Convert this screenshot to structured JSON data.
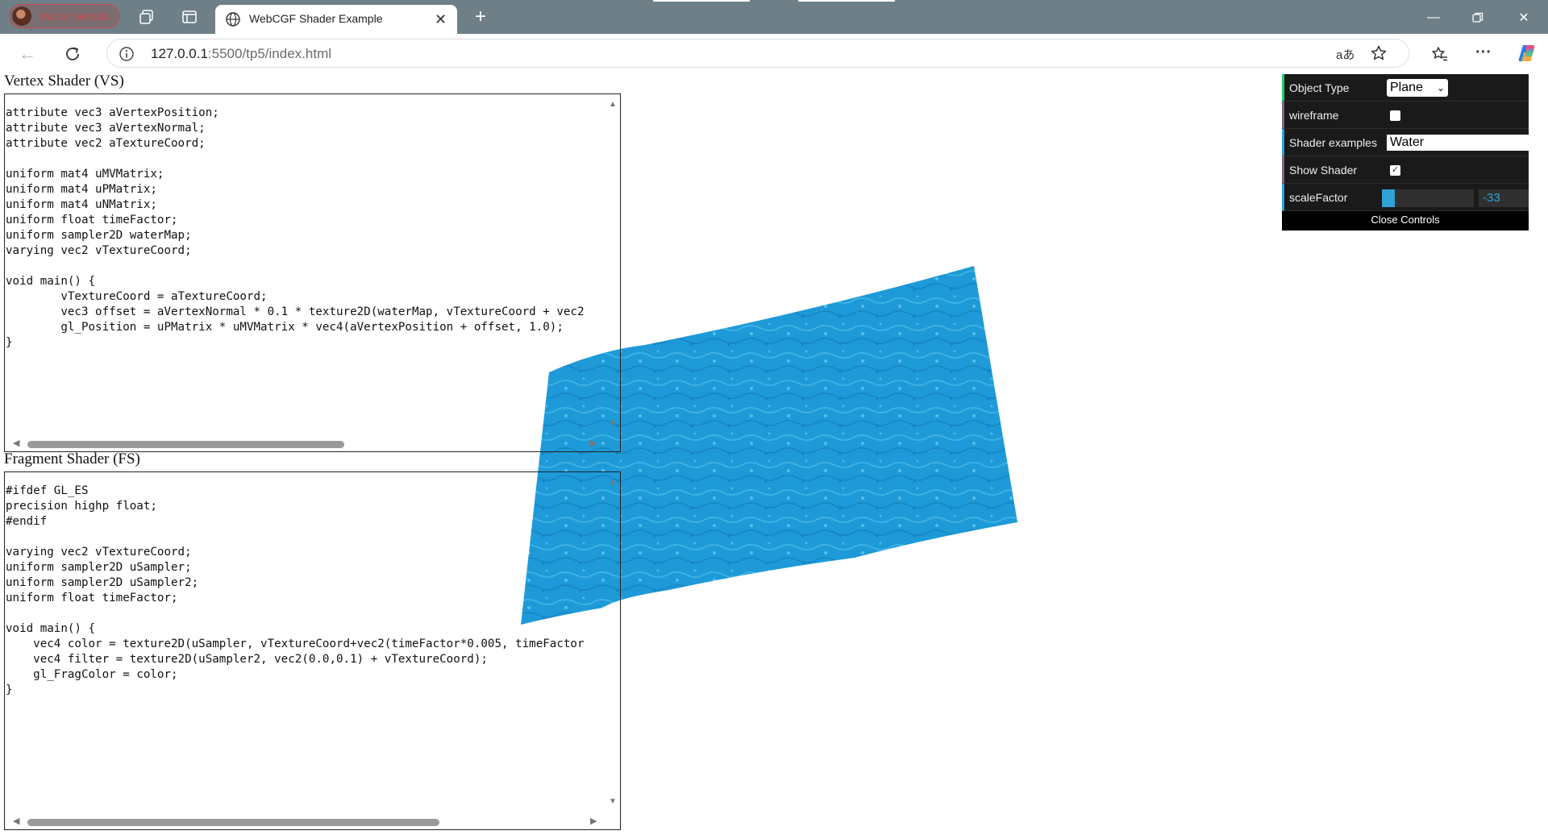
{
  "browser": {
    "profile_label": "Iniciar sessão",
    "tab_title": "WebCGF Shader Example",
    "url_host": "127.0.0.1",
    "url_rest": ":5500/tp5/index.html",
    "read_aloud_glyph": "aあ"
  },
  "vertex": {
    "title": "Vertex Shader (VS)",
    "code": "attribute vec3 aVertexPosition;\nattribute vec3 aVertexNormal;\nattribute vec2 aTextureCoord;\n\nuniform mat4 uMVMatrix;\nuniform mat4 uPMatrix;\nuniform mat4 uNMatrix;\nuniform float timeFactor;\nuniform sampler2D waterMap;\nvarying vec2 vTextureCoord;\n\nvoid main() {\n\tvTextureCoord = aTextureCoord;\n\tvec3 offset = aVertexNormal * 0.1 * texture2D(waterMap, vTextureCoord + vec2\n\tgl_Position = uPMatrix * uMVMatrix * vec4(aVertexPosition + offset, 1.0);\n}",
    "scroll_fraction": 0.57
  },
  "fragment": {
    "title": "Fragment Shader (FS)",
    "code": "#ifdef GL_ES\nprecision highp float;\n#endif\n\nvarying vec2 vTextureCoord;\nuniform sampler2D uSampler;\nuniform sampler2D uSampler2;\nuniform float timeFactor;\n\nvoid main() {\n    vec4 color = texture2D(uSampler, vTextureCoord+vec2(timeFactor*0.005, timeFactor\n    vec4 filter = texture2D(uSampler2, vec2(0.0,0.1) + vTextureCoord);\n    gl_FragColor = color;\n}",
    "scroll_fraction": 0.74
  },
  "gui": {
    "object_type_label": "Object Type",
    "object_type_value": "Plane",
    "wireframe_label": "wireframe",
    "wireframe_checked": false,
    "shader_examples_label": "Shader examples",
    "shader_examples_value": "Water",
    "show_shader_label": "Show Shader",
    "show_shader_checked": true,
    "scale_label": "scaleFactor",
    "scale_value": "-33",
    "scale_fill_fraction": 0.14,
    "close_label": "Close Controls"
  },
  "colors": {
    "water": "#1e9ad8",
    "accent": "#2fa1d6",
    "titlebar": "#6e7f87"
  }
}
